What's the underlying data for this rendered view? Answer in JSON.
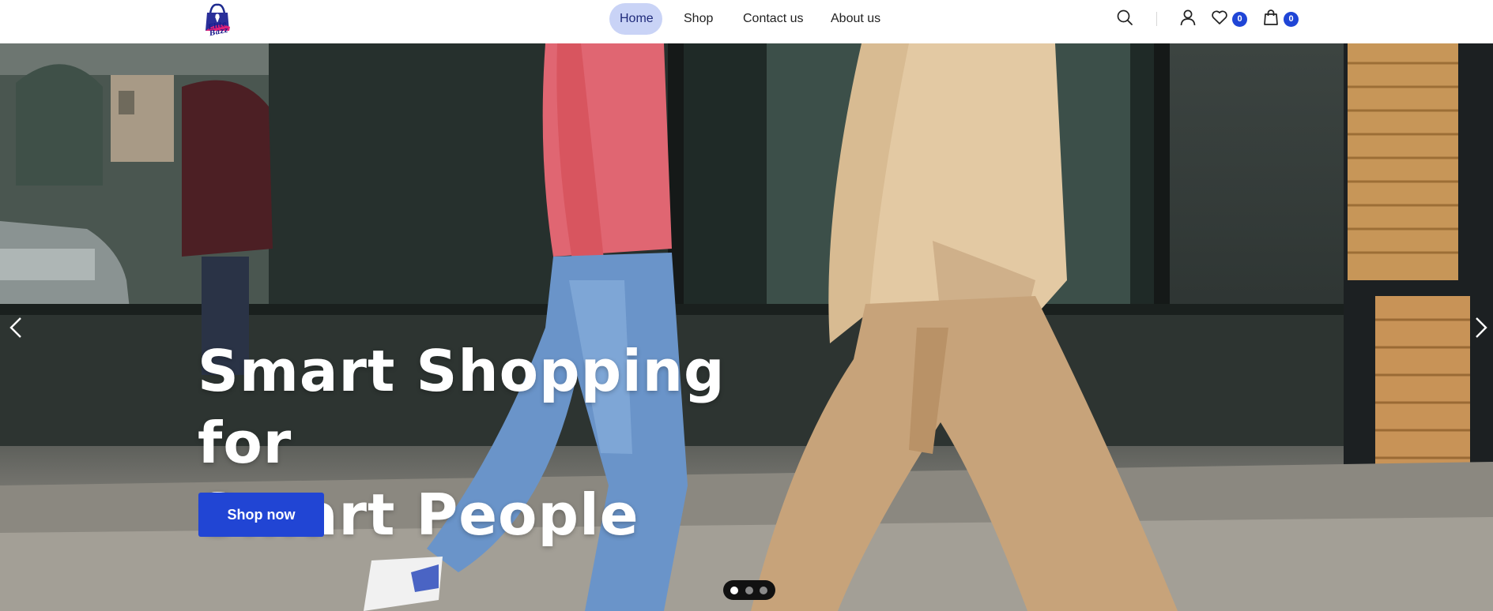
{
  "header": {
    "logo_alt": "Elite Bazz",
    "logo_text": "Elite Bazz",
    "nav": [
      {
        "label": "Home"
      },
      {
        "label": "Shop"
      },
      {
        "label": "Contact us"
      },
      {
        "label": "About us"
      }
    ],
    "icons": [
      "search-icon",
      "user-icon",
      "heart-icon",
      "shopping-bag-icon"
    ],
    "wishlist_count": "0",
    "cart_count": "0"
  },
  "hero": {
    "title_line1": "Smart Shopping for",
    "title_line2": "Smart People",
    "cta_label": "Shop now",
    "slides_total": 3,
    "active_slide": 1
  },
  "colors": {
    "accent": "#2145d4",
    "nav_active_bg": "#c9d3f6",
    "badge": "#1f45d6"
  }
}
